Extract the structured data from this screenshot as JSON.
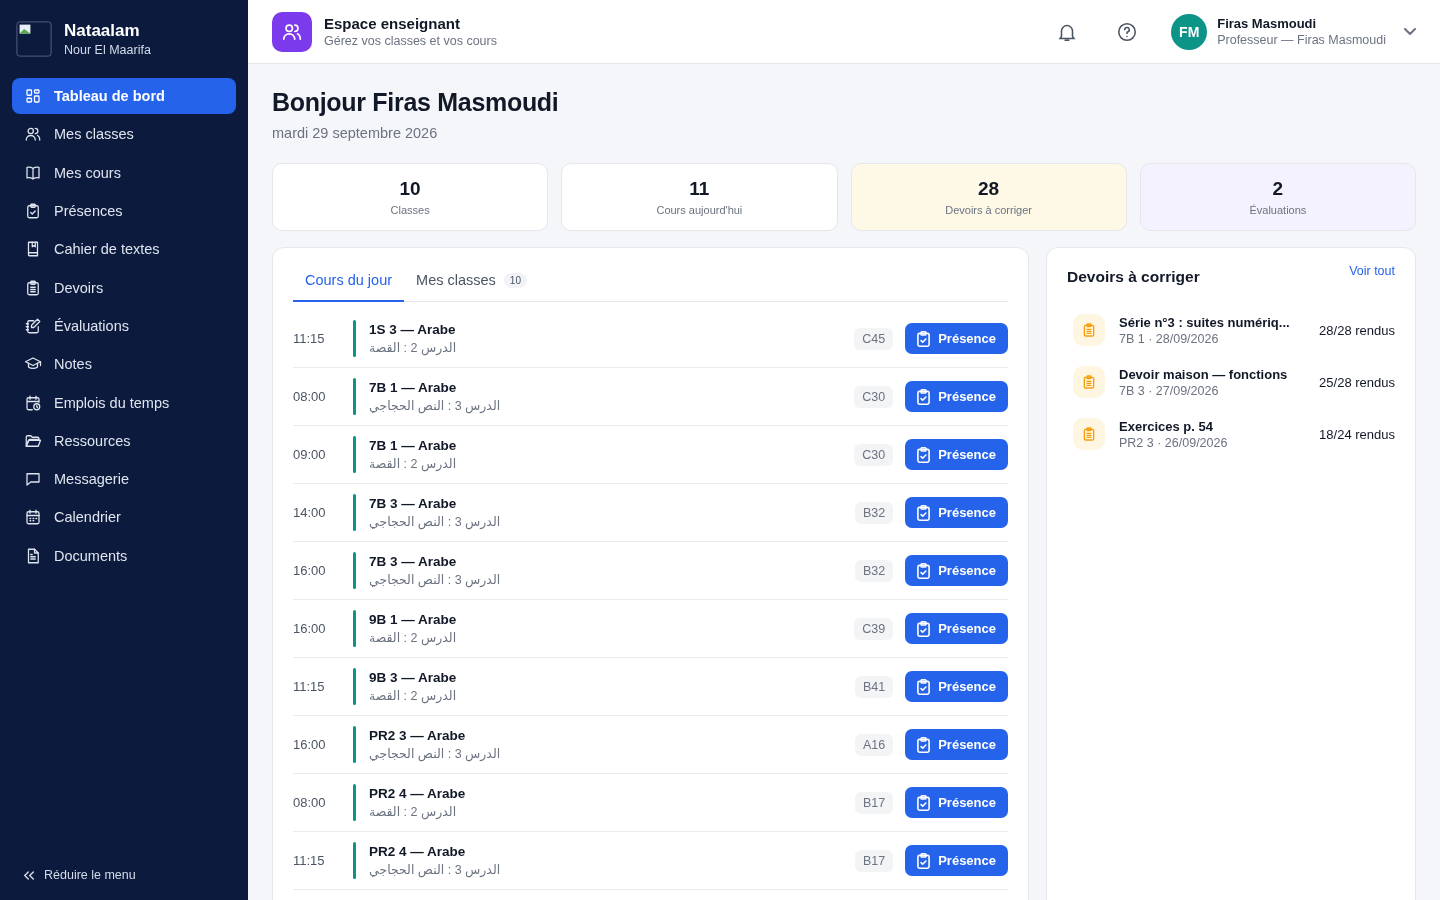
{
  "brand": {
    "name": "Nataalam",
    "subtitle": "Nour El Maarifa"
  },
  "nav": [
    {
      "label": "Tableau de bord",
      "selected": true
    },
    {
      "label": "Mes classes",
      "selected": false
    },
    {
      "label": "Mes cours",
      "selected": false
    },
    {
      "label": "Présences",
      "selected": false
    },
    {
      "label": "Cahier de textes",
      "selected": false
    },
    {
      "label": "Devoirs",
      "selected": false
    },
    {
      "label": "Évaluations",
      "selected": false
    },
    {
      "label": "Notes",
      "selected": false
    },
    {
      "label": "Emplois du temps",
      "selected": false
    },
    {
      "label": "Ressources",
      "selected": false
    },
    {
      "label": "Messagerie",
      "selected": false
    },
    {
      "label": "Calendrier",
      "selected": false
    },
    {
      "label": "Documents",
      "selected": false
    }
  ],
  "collapse": "Réduire le menu",
  "header": {
    "title": "Espace enseignant",
    "subtitle": "Gérez vos classes et vos cours",
    "user": {
      "initials": "FM",
      "name": "Firas Masmoudi",
      "role": "Professeur — Firas Masmoudi"
    }
  },
  "greeting": "Bonjour Firas Masmoudi",
  "date": "mardi 29 septembre 2026",
  "stats": [
    {
      "value": "10",
      "label": "Classes",
      "color": "#ffffff"
    },
    {
      "value": "11",
      "label": "Cours aujourd'hui",
      "color": "#ffffff"
    },
    {
      "value": "28",
      "label": "Devoirs à corriger",
      "color": "#fef9e7"
    },
    {
      "value": "2",
      "label": "Évaluations",
      "color": "#f4f2fe"
    }
  ],
  "tabs": [
    {
      "label": "Cours du jour",
      "selected": true
    },
    {
      "label": "Mes classes",
      "count": "10",
      "selected": false
    }
  ],
  "courses": [
    {
      "time": "11:15",
      "title": "1S 3 — Arabe",
      "lesson": "الدرس 2 : القصة",
      "room": "C45",
      "action": "Présence"
    },
    {
      "time": "08:00",
      "title": "7B 1 — Arabe",
      "lesson": "الدرس 3 : النص الحجاجي",
      "room": "C30",
      "action": "Présence"
    },
    {
      "time": "09:00",
      "title": "7B 1 — Arabe",
      "lesson": "الدرس 2 : القصة",
      "room": "C30",
      "action": "Présence"
    },
    {
      "time": "14:00",
      "title": "7B 3 — Arabe",
      "lesson": "الدرس 3 : النص الحجاجي",
      "room": "B32",
      "action": "Présence"
    },
    {
      "time": "16:00",
      "title": "7B 3 — Arabe",
      "lesson": "الدرس 3 : النص الحجاجي",
      "room": "B32",
      "action": "Présence"
    },
    {
      "time": "16:00",
      "title": "9B 1 — Arabe",
      "lesson": "الدرس 2 : القصة",
      "room": "C39",
      "action": "Présence"
    },
    {
      "time": "11:15",
      "title": "9B 3 — Arabe",
      "lesson": "الدرس 2 : القصة",
      "room": "B41",
      "action": "Présence"
    },
    {
      "time": "16:00",
      "title": "PR2 3 — Arabe",
      "lesson": "الدرس 3 : النص الحجاجي",
      "room": "A16",
      "action": "Présence"
    },
    {
      "time": "08:00",
      "title": "PR2 4 — Arabe",
      "lesson": "الدرس 2 : القصة",
      "room": "B17",
      "action": "Présence"
    },
    {
      "time": "11:15",
      "title": "PR2 4 — Arabe",
      "lesson": "الدرس 3 : النص الحجاجي",
      "room": "B17",
      "action": "Présence"
    }
  ],
  "homework": {
    "title": "Devoirs à corriger",
    "link": "Voir tout",
    "items": [
      {
        "title": "Série n°3 : suites numériq...",
        "meta": "7B 1 · 28/09/2026",
        "count": "28/28 rendus"
      },
      {
        "title": "Devoir maison — fonctions",
        "meta": "7B 3 · 27/09/2026",
        "count": "25/28 rendus"
      },
      {
        "title": "Exercices p. 54",
        "meta": "PR2 3 · 26/09/2026",
        "count": "18/24 rendus"
      }
    ]
  }
}
